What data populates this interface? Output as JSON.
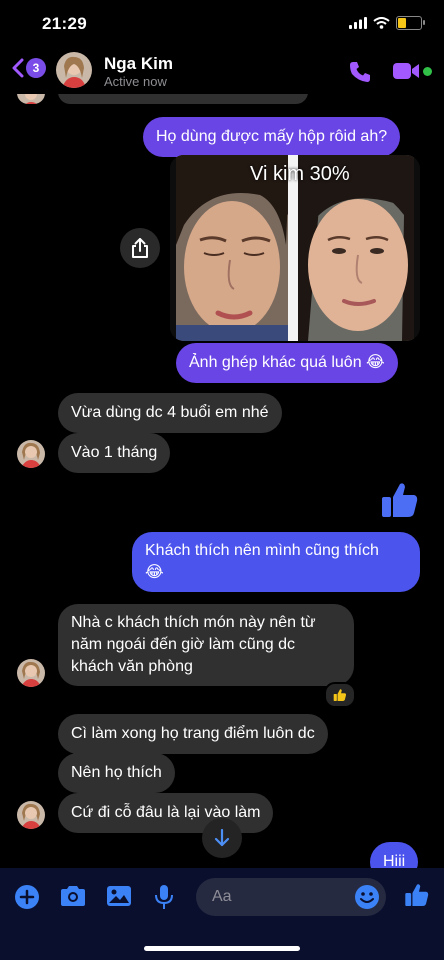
{
  "status": {
    "time": "21:29"
  },
  "header": {
    "back_badge": "3",
    "name": "Nga Kim",
    "status": "Active now"
  },
  "messages": {
    "m1": "Họ dùng được mấy hộp rôid ah?",
    "photo_caption": "Vi kim 30%",
    "m2": "Ảnh ghép khác quá luôn 😂",
    "m3": "Vừa dùng dc 4 buổi em nhé",
    "m4": "Vào 1 tháng",
    "m5_line1": "Khách thích nên mình cũng thích",
    "m5_line2": "😂",
    "m6_line1": "Nhà c khách thích món này nên từ",
    "m6_line2": "năm ngoái đến giờ làm cũng dc",
    "m6_line3": "khách văn phòng",
    "m7": "Cì làm xong họ trang điểm luôn dc",
    "m8": "Nên họ thích",
    "m9": "Cứ đi cỗ đâu là lại vào làm",
    "m10": "Hiii"
  },
  "composer": {
    "placeholder": "Aa"
  },
  "colors": {
    "accent": "#a259ff",
    "outgoing": "#6a45e6",
    "incoming": "#303030",
    "online": "#31c048"
  },
  "icons": [
    "chevron-left-icon",
    "phone-icon",
    "video-camera-icon",
    "share-icon",
    "thumbs-up-icon",
    "arrow-down-icon",
    "plus-icon",
    "camera-icon",
    "image-icon",
    "microphone-icon",
    "emoji-icon"
  ]
}
